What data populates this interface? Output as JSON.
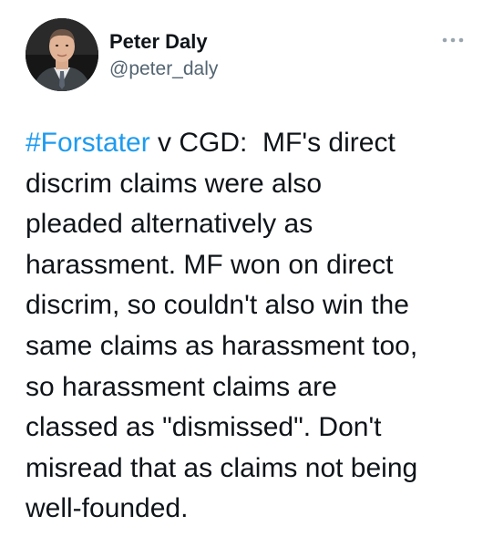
{
  "author": {
    "name": "Peter Daly",
    "handle": "@peter_daly",
    "avatar_icon": "profile-photo"
  },
  "more_icon": "more-horizontal-icon",
  "tweet": {
    "hashtag": "#Forstater",
    "text": " v CGD:  MF's direct\ndiscrim claims were also\npleaded alternatively as\nharassment. MF won on direct\ndiscrim, so couldn't also win the\nsame claims as harassment too,\nso harassment claims are\nclassed as \"dismissed\". Don't\nmisread that as claims not being\nwell-founded."
  },
  "colors": {
    "link": "#1d9bf0",
    "text": "#0f1419",
    "secondary": "#536471"
  }
}
